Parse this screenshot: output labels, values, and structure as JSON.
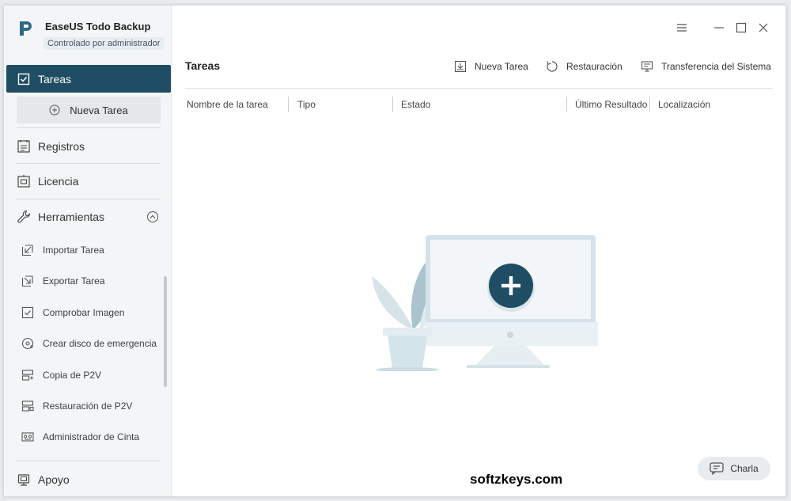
{
  "app": {
    "title": "EaseUS Todo Backup",
    "subtitle": "Controlado por administrador"
  },
  "sidebar": {
    "active_item": "Tareas",
    "new_task": "Nueva Tarea",
    "items": [
      "Registros",
      "Licencia",
      "Herramientas"
    ],
    "tools": [
      "Importar Tarea",
      "Exportar Tarea",
      "Comprobar Imagen",
      "Crear disco de emergencia",
      "Copia de P2V",
      "Restauración de P2V",
      "Administrador de Cinta"
    ],
    "support": "Apoyo"
  },
  "main": {
    "title": "Tareas",
    "actions": [
      "Nueva Tarea",
      "Restauración",
      "Transferencia del Sistema"
    ],
    "columns": [
      "Nombre de la tarea",
      "Tipo",
      "Estado",
      "Último Resultado",
      "Localización"
    ]
  },
  "chat": {
    "label": "Charla"
  },
  "watermark": "softzkeys.com",
  "colors": {
    "accent": "#1f4e64",
    "illustration": "#c9dbe3"
  }
}
